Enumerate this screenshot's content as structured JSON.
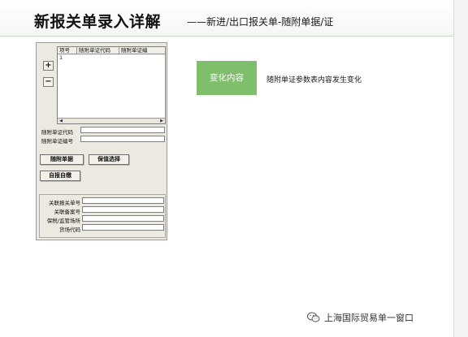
{
  "slide": {
    "title": "新报关单录入详解",
    "subtitle": "——新进/出口报关单-随附单据/证"
  },
  "form": {
    "add_label": "+",
    "remove_label": "−",
    "grid_columns": [
      "项号",
      "随附单证代码",
      "随附单证编"
    ],
    "grid_rows": [
      [
        "1",
        "",
        ""
      ]
    ],
    "scroll_left": "◀",
    "scroll_right": "▶",
    "doc_code_label": "随附单证代码",
    "doc_code_value": "",
    "doc_number_label": "随附单证编号",
    "doc_number_value": "",
    "attached_docs_button": "随附单据",
    "guarantee_button": "保值选择",
    "self_report_button": "自报自缴",
    "related_declaration_label": "关联报关单号",
    "related_declaration_value": "",
    "related_record_label": "关联备案号",
    "related_record_value": "",
    "bonded_site_label": "保税/监管场所",
    "bonded_site_value": "",
    "yard_code_label": "货场代码",
    "yard_code_value": ""
  },
  "change": {
    "box_label": "变化内容",
    "description": "随附单证参数表内容发生变化"
  },
  "footer": {
    "icon": "wechat-icon",
    "text": "上海国际贸易单一窗口"
  },
  "colors": {
    "accent_green": "#7fbf6b",
    "panel_bg": "#ece9e0"
  }
}
